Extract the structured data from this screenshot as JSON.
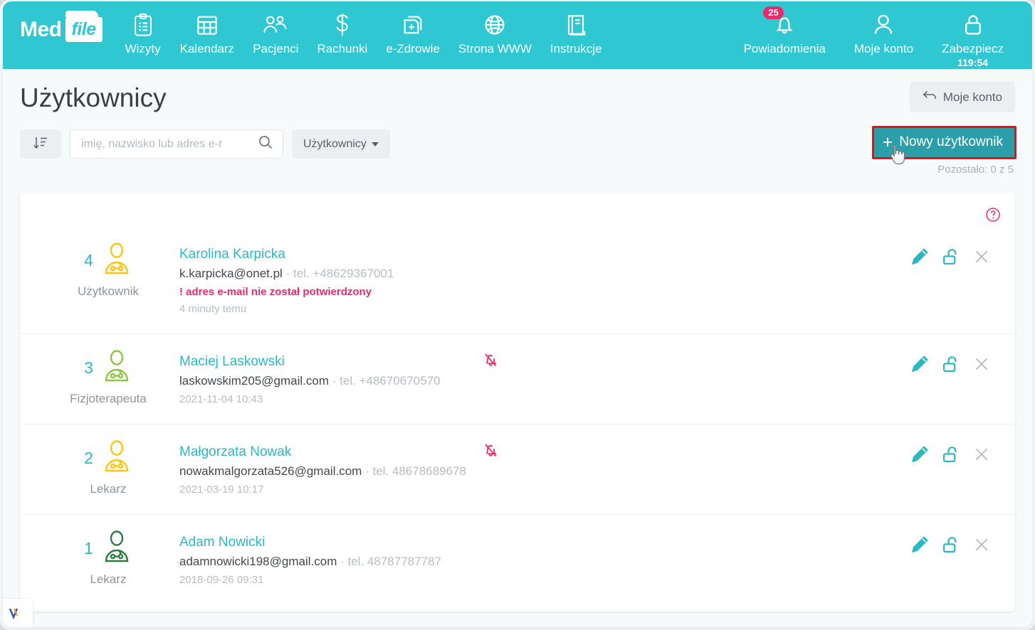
{
  "brand": {
    "logo_text_1": "Med",
    "logo_text_2": "file",
    "teal": "#2ec7d2",
    "accent_pink": "#ea2a6b",
    "button_teal": "#2a9ea9",
    "highlight_red": "#f10d0d"
  },
  "topnav": {
    "items": [
      {
        "label": "Wizyty",
        "icon": "clipboard-icon"
      },
      {
        "label": "Kalendarz",
        "icon": "calendar-icon"
      },
      {
        "label": "Pacjenci",
        "icon": "patients-icon"
      },
      {
        "label": "Rachunki",
        "icon": "dollar-icon"
      },
      {
        "label": "e-Zdrowie",
        "icon": "ehealth-icon"
      },
      {
        "label": "Strona WWW",
        "icon": "globe-icon"
      },
      {
        "label": "Instrukcje",
        "icon": "book-icon"
      }
    ],
    "right_items": [
      {
        "label": "Powiadomienia",
        "icon": "bell-icon",
        "badge": "25"
      },
      {
        "label": "Moje konto",
        "icon": "user-icon"
      },
      {
        "label": "Zabezpiecz",
        "icon": "lock-icon",
        "timer": "119:54"
      }
    ]
  },
  "page": {
    "title": "Użytkownicy",
    "my_account_button": "Moje konto",
    "my_account_icon": "back-arrow-icon"
  },
  "toolbar": {
    "sort_icon": "sort-descending-icon",
    "search_placeholder": "imię, nazwisko lub adres e-r",
    "search_value": "",
    "search_icon": "search-icon",
    "filter_label": "Użytkownicy",
    "new_user_label": "Nowy użytkownik",
    "new_user_plus": "+",
    "remaining_label": "Pozostało: 0 z 5"
  },
  "card": {
    "help_icon": "question-mark-icon",
    "rows": [
      {
        "number": "4",
        "role": "Użytkownik",
        "icon_color": "#ffc312",
        "number_color": "#2bb7c4",
        "name": "Karolina Karpicka",
        "email": "k.karpicka@onet.pl",
        "separator": "·",
        "tel_prefix": "tel.",
        "phone": "+48629367001",
        "warning": "! adres e-mail nie został potwierdzony",
        "date": "4 minuty temu",
        "muted": false,
        "actions": [
          "edit-icon",
          "unlock-icon",
          "delete-icon"
        ]
      },
      {
        "number": "3",
        "role": "Fizjoterapeuta",
        "icon_color": "#8cc63f",
        "number_color": "#2bb7c4",
        "name": "Maciej Laskowski",
        "email": "laskowskim205@gmail.com",
        "separator": "·",
        "tel_prefix": "tel.",
        "phone": "+48670670570",
        "warning": "",
        "date": "2021-11-04 10:43",
        "muted": true,
        "actions": [
          "edit-icon",
          "unlock-icon",
          "delete-icon"
        ]
      },
      {
        "number": "2",
        "role": "Lekarz",
        "icon_color": "#ffc312",
        "number_color": "#2bb7c4",
        "name": "Małgorzata Nowak",
        "email": "nowakmalgorzata526@gmail.com",
        "separator": "·",
        "tel_prefix": "tel.",
        "phone": "48678689678",
        "warning": "",
        "date": "2021-03-19 10:17",
        "muted": true,
        "actions": [
          "edit-icon",
          "unlock-icon",
          "delete-icon"
        ]
      },
      {
        "number": "1",
        "role": "Lekarz",
        "icon_color": "#2a7d3f",
        "number_color": "#2bb7c4",
        "name": "Adam Nowicki",
        "email": "adamnowicki198@gmail.com",
        "separator": "·",
        "tel_prefix": "tel.",
        "phone": "48787787787",
        "warning": "",
        "date": "2018-09-26 09:31",
        "muted": false,
        "actions": [
          "edit-icon",
          "unlock-icon",
          "delete-icon"
        ]
      }
    ]
  }
}
